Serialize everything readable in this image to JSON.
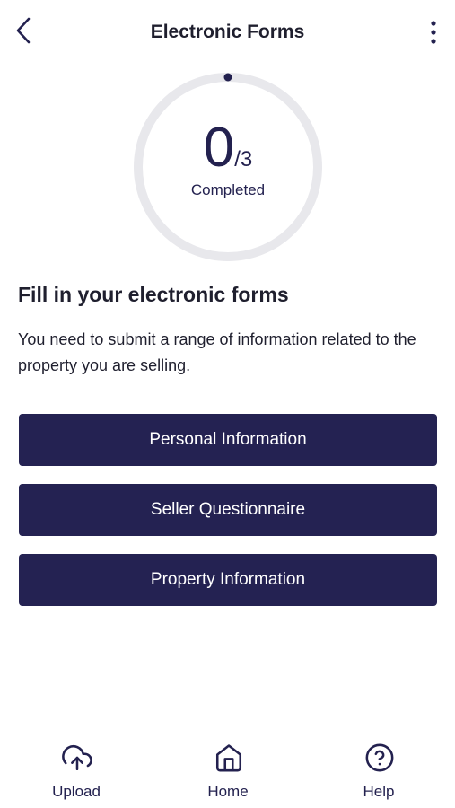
{
  "header": {
    "title": "Electronic Forms",
    "back_icon": "chevron-left-icon",
    "menu_icon": "more-vertical-icon"
  },
  "progress": {
    "completed": "0",
    "total": "/3",
    "label": "Completed",
    "fraction": 0
  },
  "intro": {
    "title": "Fill in your electronic forms",
    "description": "You need to submit a range of information related to the property you are selling."
  },
  "forms": [
    {
      "label": "Personal Information"
    },
    {
      "label": "Seller Questionnaire"
    },
    {
      "label": "Property Information"
    }
  ],
  "nav": [
    {
      "label": "Upload",
      "icon": "cloud-upload-icon"
    },
    {
      "label": "Home",
      "icon": "home-icon"
    },
    {
      "label": "Help",
      "icon": "help-circle-icon"
    }
  ],
  "colors": {
    "primary": "#242252",
    "ring_track": "#e8e8ec",
    "text": "#1f1f2e",
    "button_text": "#ffffff"
  }
}
